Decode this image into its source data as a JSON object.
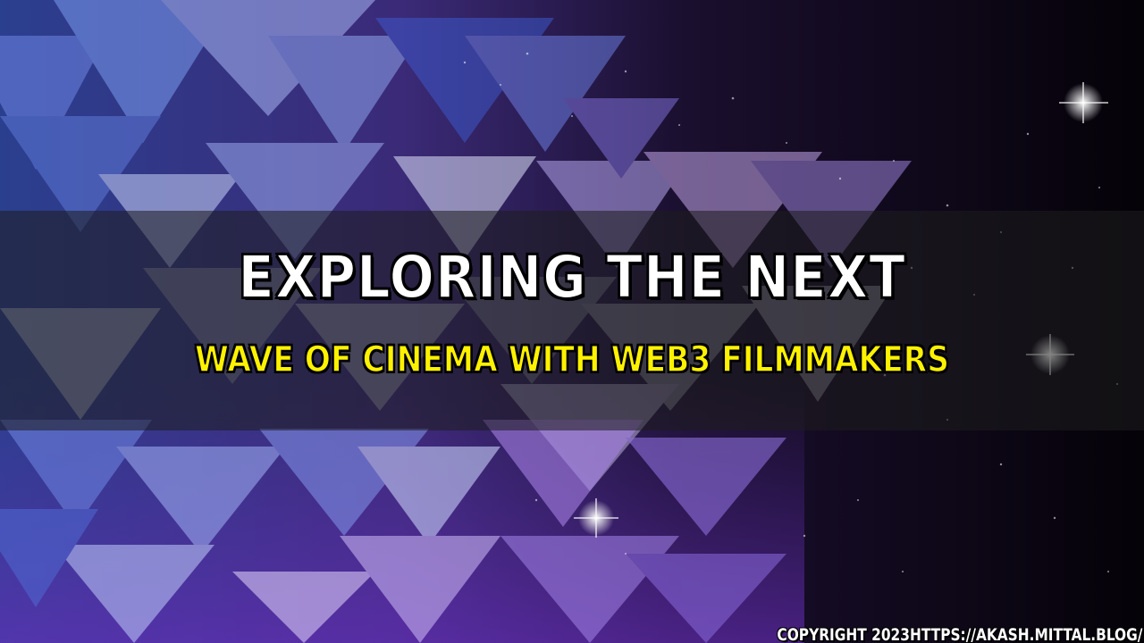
{
  "headline": {
    "line1": "EXPLORING THE NEXT",
    "line2": "WAVE OF CINEMA WITH WEB3 FILMMAKERS"
  },
  "footer": {
    "copyright": "COPYRIGHT 2023HTTPS://AKASH.MITTAL.BLOG/"
  },
  "colors": {
    "line1_text": "#ffffff",
    "line2_text": "#fff200",
    "outline": "#000000",
    "band_overlay": "#1e1e1e",
    "background_dark": "#0a0614",
    "accent_blue": "#3a5bd9",
    "accent_purple": "#8a3ad9"
  }
}
